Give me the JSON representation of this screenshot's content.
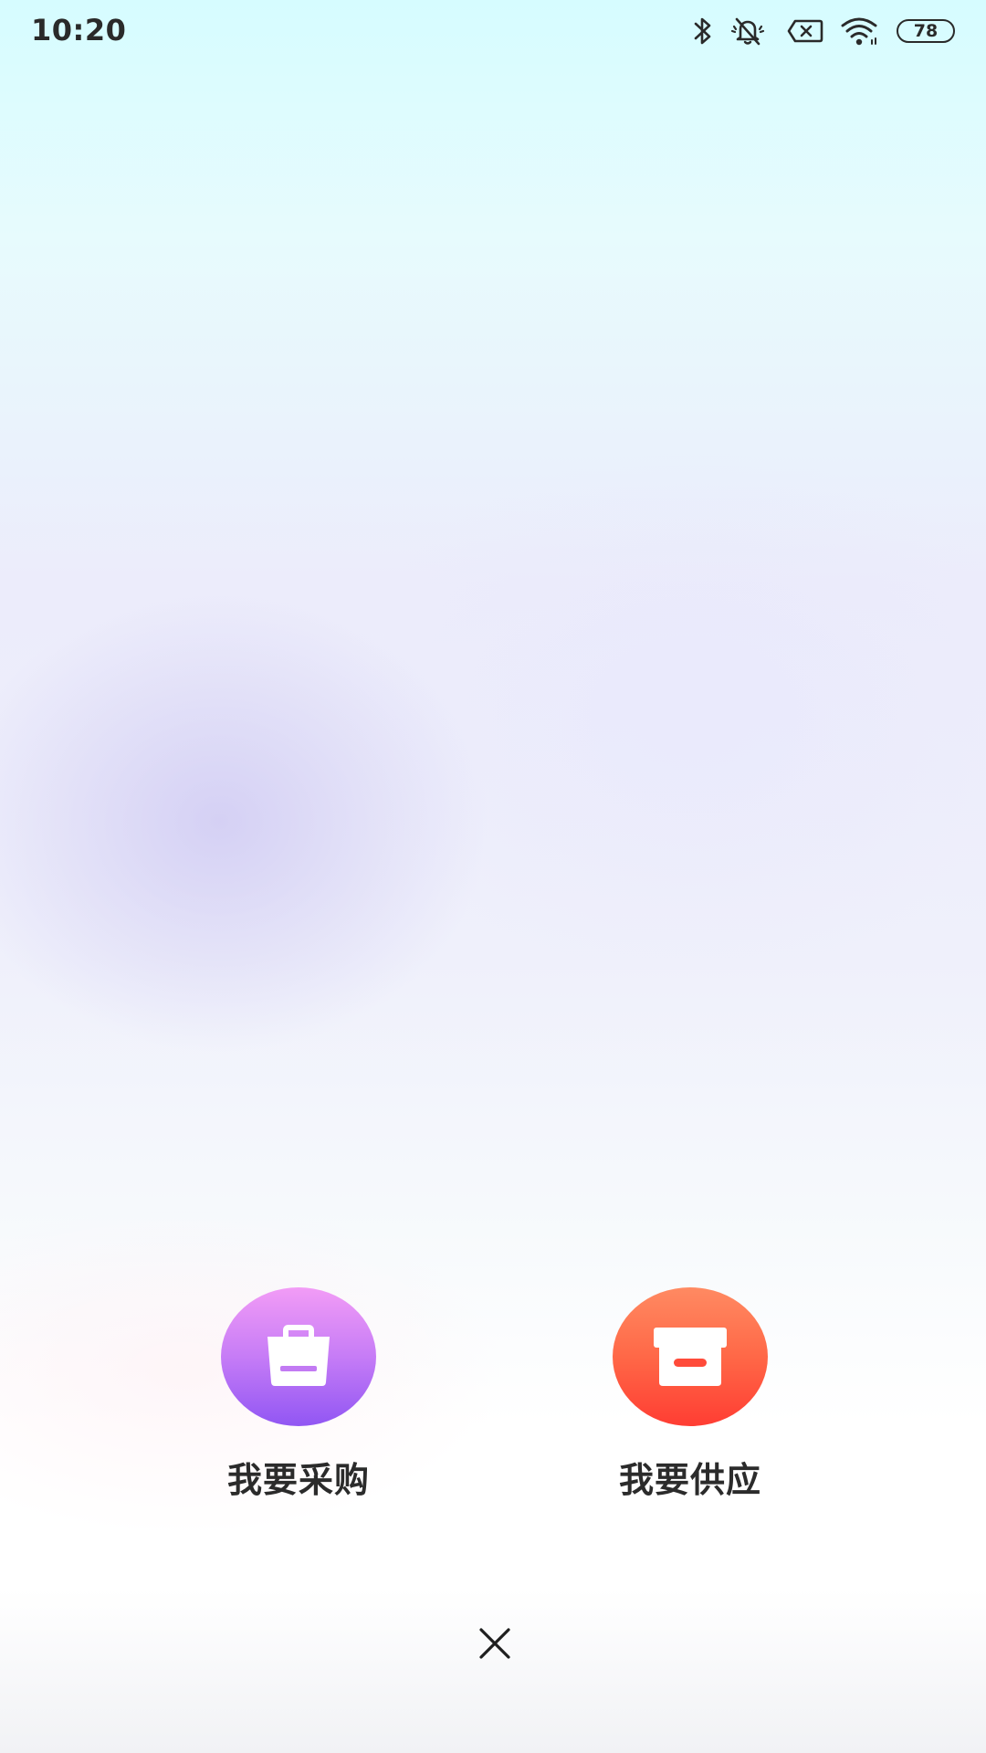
{
  "status_bar": {
    "time": "10:20",
    "battery_level": "78",
    "icons": [
      "bluetooth-icon",
      "silent-bell-icon",
      "no-sim-icon",
      "wifi-icon",
      "battery-icon"
    ]
  },
  "options": [
    {
      "label": "我要采购",
      "icon": "shopping-bag-icon",
      "color_top": "#f29cf6",
      "color_bottom": "#9156f3"
    },
    {
      "label": "我要供应",
      "icon": "archive-box-icon",
      "color_top": "#ff8a62",
      "color_bottom": "#ff3d33"
    }
  ],
  "close": {
    "icon": "close-icon"
  }
}
